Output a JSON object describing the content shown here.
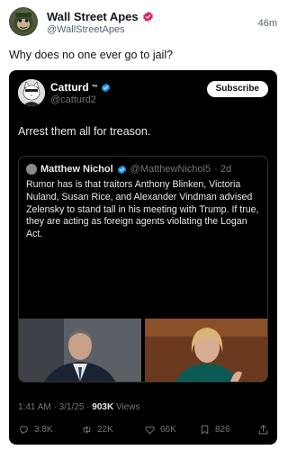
{
  "outer_post": {
    "author_name": "Wall Street Apes",
    "author_handle": "@WallStreetApes",
    "time": "46m",
    "text": "Why does no one ever go to jail?"
  },
  "embedded_post": {
    "author_name": "Catturd",
    "author_tm": "™",
    "author_handle": "@catturd2",
    "subscribe_label": "Subscribe",
    "text": "Arrest them all for treason.",
    "quoted": {
      "author_name": "Matthew Nichol",
      "author_handle": "@MatthewNichol5",
      "time": "· 2d",
      "text": "Rumor has is that traitors Anthony Blinken, Victoria Nuland, Susan Rice, and Alexander Vindman advised Zelensky to stand tall in his meeting with Trump. If true, they are acting as foreign agents violating the Logan Act."
    },
    "meta": {
      "time": "1:41 AM · 3/1/25 · ",
      "views_count": "903K",
      "views_label": " Views"
    },
    "actions": {
      "replies": "3.8K",
      "reposts": "22K",
      "likes": "66K",
      "bookmarks": "826"
    }
  },
  "colors": {
    "card_bg": "#000000",
    "verified_pink": "#e0245e",
    "verified_blue": "#1d9bf0",
    "muted_text": "#71767b"
  }
}
